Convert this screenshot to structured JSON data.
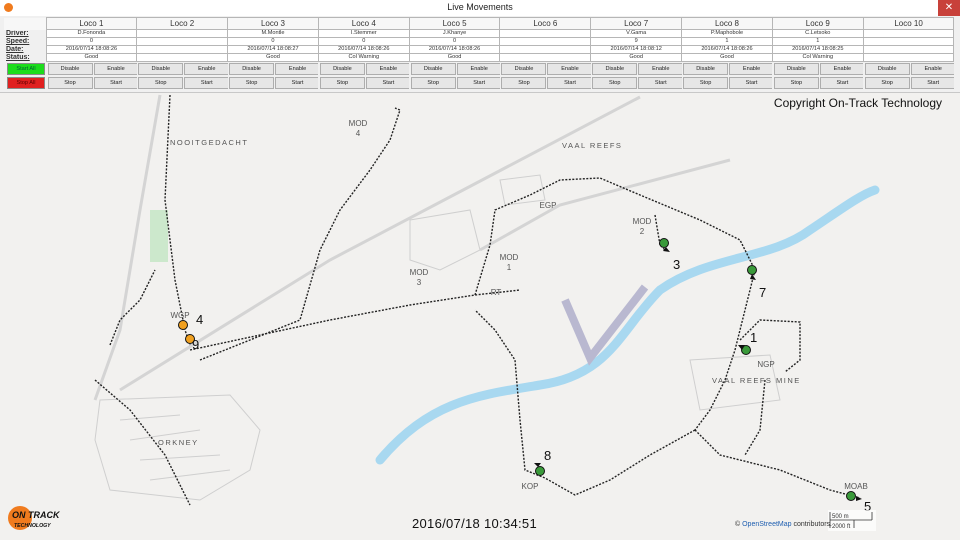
{
  "window": {
    "title": "Live Movements",
    "close_glyph": "✕"
  },
  "panel": {
    "row_labels": {
      "driver": "Driver:",
      "speed": "Speed:",
      "date": "Date:",
      "status": "Status:"
    },
    "start_all": "Start All",
    "stop_all": "Stop All",
    "btn": {
      "disable": "Disable",
      "enable": "Enable",
      "stop": "Stop",
      "start": "Start"
    },
    "locos": [
      {
        "name": "Loco 1",
        "driver": "D.Fononda",
        "speed": "0",
        "date": "2016/07/14 18:08:26",
        "status": "Good"
      },
      {
        "name": "Loco 2",
        "driver": "",
        "speed": "",
        "date": "",
        "status": ""
      },
      {
        "name": "Loco 3",
        "driver": "M.Montle",
        "speed": "0",
        "date": "2016/07/14 18:08:27",
        "status": "Good"
      },
      {
        "name": "Loco 4",
        "driver": "I.Stemmer",
        "speed": "0",
        "date": "2016/07/14 18:08:26",
        "status": "Col Warning"
      },
      {
        "name": "Loco 5",
        "driver": "J.Khanye",
        "speed": "0",
        "date": "2016/07/14 18:08:26",
        "status": "Good"
      },
      {
        "name": "Loco 6",
        "driver": "",
        "speed": "",
        "date": "",
        "status": ""
      },
      {
        "name": "Loco 7",
        "driver": "V.Gama",
        "speed": "9",
        "date": "2016/07/14 18:08:12",
        "status": "Good"
      },
      {
        "name": "Loco 8",
        "driver": "P.Maphobole",
        "speed": "1",
        "date": "2016/07/14 18:08:26",
        "status": "Good"
      },
      {
        "name": "Loco 9",
        "driver": "C.Letsoko",
        "speed": "1",
        "date": "2016/07/14 18:08:25",
        "status": "Col Warning"
      },
      {
        "name": "Loco 10",
        "driver": "",
        "speed": "",
        "date": "",
        "status": ""
      }
    ]
  },
  "map": {
    "copyright": "Copyright On-Track Technology",
    "timestamp": "2016/07/18 10:34:51",
    "osm_prefix": "© ",
    "osm_link": "OpenStreetMap",
    "osm_suffix": " contributors.",
    "scale_m": "500 m",
    "scale_ft": "2000 ft",
    "logo_top": "ON TRACK",
    "logo_bottom": "TECHNOLOGY",
    "places": {
      "nooitgedacht": "NOOITGEDACHT",
      "vaal_reefs": "VAAL REEFS",
      "orkney": "ORKNEY",
      "vaal_reefs_mine": "VAAL REEFS MINE",
      "mod4a": "MOD",
      "mod4b": "4",
      "mod2a": "MOD",
      "mod2b": "2",
      "mod1a": "MOD",
      "mod1b": "1",
      "mod3a": "MOD",
      "mod3b": "3",
      "egp": "EGP",
      "rt": "RT",
      "wgp": "WGP",
      "kop": "KOP",
      "ngp": "NGP",
      "moab": "MOAB"
    },
    "loco_markers": {
      "m1": "1",
      "m3": "3",
      "m4": "4",
      "m5": "5",
      "m7": "7",
      "m8": "8",
      "m9": "9"
    },
    "colors": {
      "good": "#3a9a3a",
      "warning": "#f0a020",
      "river": "#a8d8f0",
      "rail": "#222222"
    }
  }
}
